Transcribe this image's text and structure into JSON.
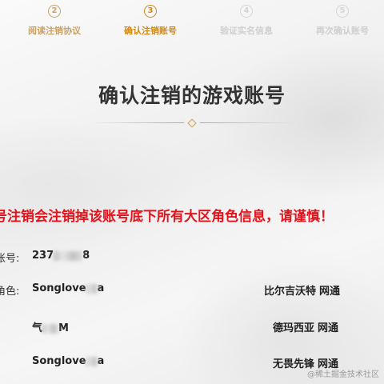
{
  "steps": [
    {
      "number": "2",
      "label": "阅读注销协议",
      "state": "done"
    },
    {
      "number": "3",
      "label": "确认注销账号",
      "state": "active"
    },
    {
      "number": "4",
      "label": "验证实名信息",
      "state": "inactive"
    },
    {
      "number": "5",
      "label": "再次确认账号",
      "state": "inactive"
    }
  ],
  "title": "确认注销的游戏账号",
  "warning": "号注销会注销掉该账号底下所有大区角色信息，请谨慎！",
  "account": {
    "label": "账号:",
    "value_start": "237",
    "value_end": "8"
  },
  "roles_label": "角色:",
  "roles": [
    {
      "name_start": "Songlove",
      "name_end": "a",
      "server": "比尔吉沃特",
      "network": "网通"
    },
    {
      "name_start": "气",
      "name_end": "M",
      "server": "德玛西亚",
      "network": "网通"
    },
    {
      "name_start": "Songlove",
      "name_end": "a",
      "server": "无畏先锋",
      "network": "网通"
    }
  ],
  "watermark": "@稀土掘金技术社区",
  "colors": {
    "accent": "#d08a1a",
    "gold": "#c9a268",
    "warning": "#e3121b"
  }
}
